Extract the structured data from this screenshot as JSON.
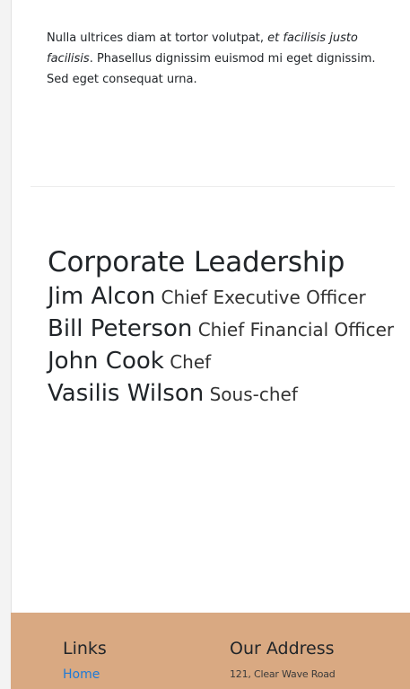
{
  "intro": {
    "text_before_italic": "Nulla ultrices diam at tortor volutpat, ",
    "italic_text": "et facilisis justo facilisis",
    "text_after_italic": ". Phasellus dignissim euismod mi eget dignissim. Sed eget consequat urna."
  },
  "leadership": {
    "title": "Corporate Leadership",
    "members": [
      {
        "name": "Jim Alcon",
        "role": "Chief Executive Officer"
      },
      {
        "name": "Bill Peterson",
        "role": "Chief Financial Officer"
      },
      {
        "name": "John Cook",
        "role": "Chef"
      },
      {
        "name": "Vasilis Wilson",
        "role": "Sous-chef"
      }
    ]
  },
  "footer": {
    "links_heading": "Links",
    "links": [
      {
        "label": "Home"
      }
    ],
    "address_heading": "Our Address",
    "address_line_1": "121, Clear Wave Road"
  },
  "colors": {
    "footer_background": "#d9a982",
    "link": "#1f7ad6"
  }
}
